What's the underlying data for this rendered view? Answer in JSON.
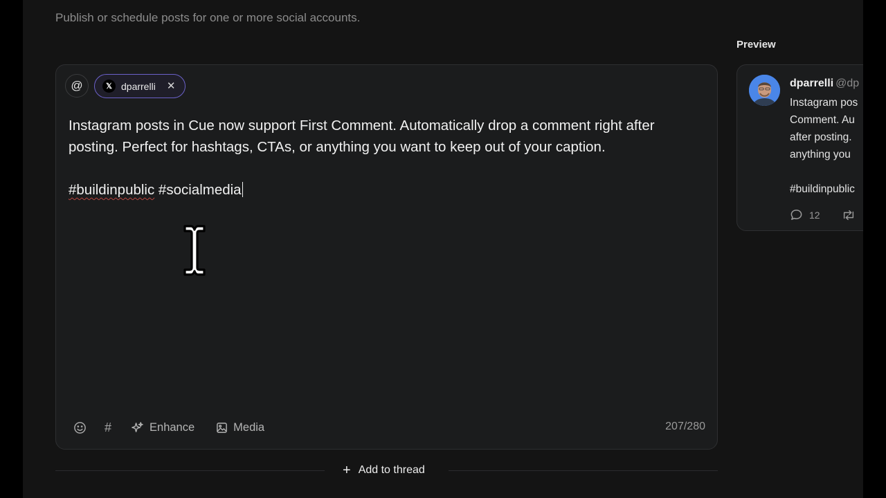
{
  "header": {
    "subtitle": "Publish or schedule posts for one or more social accounts."
  },
  "composer": {
    "mention_icon": "at-sign-icon",
    "account": {
      "platform_icon": "x-logo-icon",
      "platform_glyph": "𝕏",
      "name": "dparrelli",
      "remove_icon": "close-icon",
      "remove_glyph": "✕"
    },
    "body": {
      "line1": "Instagram posts in Cue now support First Comment. Automatically drop a comment right after posting. Perfect for hashtags, CTAs, or anything you want to keep out of your caption.",
      "tag1": "#buildinpublic",
      "tag2": " #socialmedia"
    },
    "toolbar": {
      "emoji_icon": "smile-icon",
      "hashtag_icon": "hashtag-icon",
      "hashtag_glyph": "#",
      "enhance_label": "Enhance",
      "enhance_icon": "sparkles-icon",
      "media_label": "Media",
      "media_icon": "image-icon"
    },
    "char_count": "207/280"
  },
  "thread": {
    "add_label": "Add to thread",
    "add_glyph": "+"
  },
  "preview": {
    "title": "Preview",
    "name": "dparrelli",
    "handle": "@dp",
    "lines": [
      "Instagram pos",
      "Comment. Au",
      "after posting.",
      "anything you",
      "",
      "#buildinpublic"
    ],
    "reply_count": "12",
    "reply_icon": "comment-icon",
    "repost_icon": "repost-icon"
  },
  "colors": {
    "background": "#141414",
    "card": "#1b1c1d",
    "chip_border": "#6b61c9",
    "text": "#f1f1f1",
    "muted": "#8c8c8c"
  }
}
